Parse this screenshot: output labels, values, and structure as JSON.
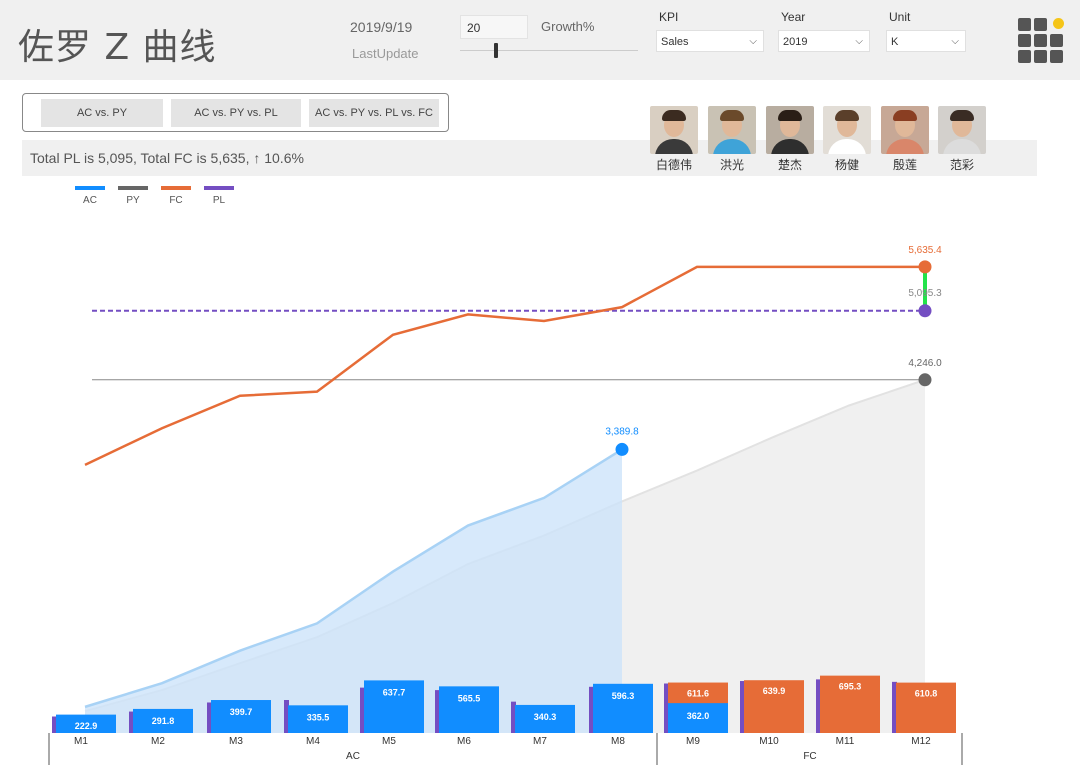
{
  "header": {
    "title": "佐罗 Z 曲线",
    "date": "2019/9/19",
    "last_update_label": "LastUpdate",
    "growth_value": "20",
    "growth_label": "Growth%",
    "growth_slider_value": 20
  },
  "filters": {
    "kpi": {
      "label": "KPI",
      "value": "Sales"
    },
    "year": {
      "label": "Year",
      "value": "2019"
    },
    "unit": {
      "label": "Unit",
      "value": "K"
    }
  },
  "view_buttons": [
    "AC vs. PY",
    "AC vs. PY vs. PL",
    "AC vs. PY vs. PL vs. FC"
  ],
  "summary": "Total PL is 5,095, Total FC is 5,635, ↑ 10.6%",
  "people": [
    {
      "name": "白德伟",
      "icon": "person-photo"
    },
    {
      "name": "洪光",
      "icon": "person-photo"
    },
    {
      "name": "楚杰",
      "icon": "person-photo"
    },
    {
      "name": "杨健",
      "icon": "person-photo"
    },
    {
      "name": "殷莲",
      "icon": "person-photo"
    },
    {
      "name": "范彩",
      "icon": "person-photo"
    }
  ],
  "colors": {
    "ac": "#118DFF",
    "py": "#666666",
    "fc": "#E66C37",
    "pl": "#744EC2",
    "gap": "#22E34A",
    "ac_area": "#CDE4FA",
    "py_area": "#EBEBEB"
  },
  "chart_data": {
    "type": "line",
    "title": "",
    "legend": [
      "AC",
      "PY",
      "FC",
      "PL"
    ],
    "legend_position": "top-left",
    "categories": [
      "M1",
      "M2",
      "M3",
      "M4",
      "M5",
      "M6",
      "M7",
      "M8",
      "M9",
      "M10",
      "M11",
      "M12"
    ],
    "groups": [
      {
        "label": "AC",
        "months": [
          "M1",
          "M2",
          "M3",
          "M4",
          "M5",
          "M6",
          "M7",
          "M8"
        ]
      },
      {
        "label": "FC",
        "months": [
          "M9",
          "M10",
          "M11",
          "M12"
        ]
      }
    ],
    "monthly_bars": {
      "ac": [
        222.9,
        291.8,
        399.7,
        335.5,
        637.7,
        565.5,
        340.3,
        596.3,
        null,
        null,
        null,
        null
      ],
      "fc": [
        null,
        null,
        null,
        null,
        null,
        null,
        null,
        null,
        611.6,
        639.9,
        695.3,
        610.8
      ],
      "ac_partial": [
        null,
        null,
        null,
        null,
        null,
        null,
        null,
        null,
        362.0,
        null,
        null,
        null
      ],
      "pl": [
        200,
        260,
        370,
        400,
        550,
        520,
        380,
        560,
        600,
        630,
        650,
        620
      ]
    },
    "series": [
      {
        "name": "AC",
        "type": "area-cumulative",
        "values": [
          222.9,
          514.7,
          914.4,
          1249.9,
          1887.6,
          2453.1,
          2793.4,
          3389.8
        ],
        "end_label": "3,389.8"
      },
      {
        "name": "PY",
        "type": "area-cumulative",
        "values": [
          170,
          430,
          760,
          1080,
          1500,
          1980,
          2330,
          2750,
          3130,
          3540,
          3930,
          4246.0
        ],
        "end_label": "4,246.0"
      },
      {
        "name": "FC",
        "type": "line",
        "values": [
          3200,
          3650,
          4050,
          4100,
          4800,
          5050,
          4970,
          5140,
          5635.4,
          5635.4,
          5635.4,
          5635.4
        ],
        "end_label": "5,635.4"
      },
      {
        "name": "PL",
        "type": "reference",
        "values": [
          5095.3
        ],
        "end_label": "5,095.3"
      },
      {
        "name": "PY total",
        "type": "reference",
        "values": [
          4246.0
        ]
      }
    ],
    "ylim": [
      0,
      6000
    ],
    "grid": false
  }
}
